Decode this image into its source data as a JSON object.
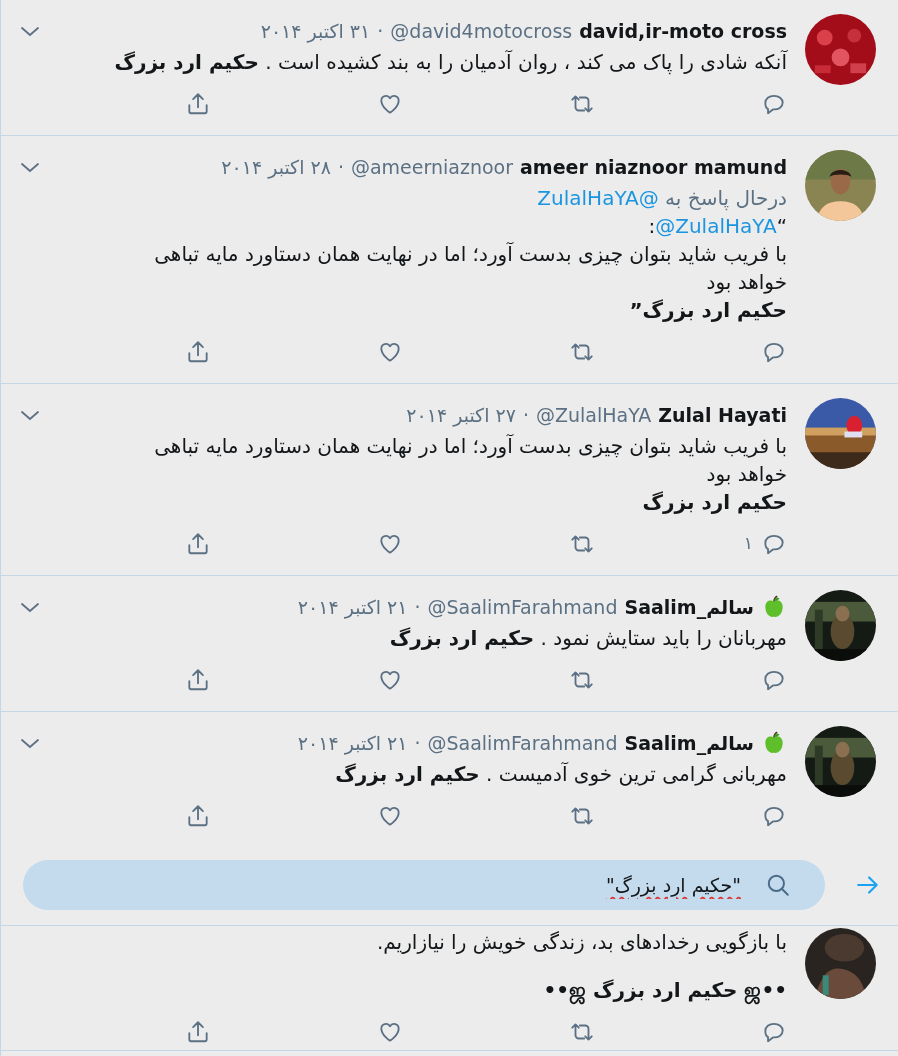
{
  "tweets": [
    {
      "avatar": {
        "kind": "picture"
      },
      "name": "david,ir-moto cross",
      "name_badge": false,
      "handle": "@david4motocross",
      "separator": "·",
      "date": "۳۱ اکتبر ۲۰۱۴",
      "menu": true,
      "body": [
        {
          "kind": "text",
          "text": "آنکه شادی را پاک می کند ، روان آدمیان را به بند کشیده است . **حکیم ارد بزرگ**"
        }
      ]
    },
    {
      "avatar": {
        "kind": "picture"
      },
      "name": "ameer niaznoor mamund",
      "name_badge": false,
      "handle": "@ameerniaznoor",
      "separator": "·",
      "date": "۲۸ اکتبر ۲۰۱۴",
      "menu": true,
      "reply_to": {
        "prefix": "درحال پاسخ به",
        "mention": "@ZulalHaYA"
      },
      "body": [
        {
          "kind": "mention",
          "before": "“",
          "mention": "@ZulalHaYA",
          "after": ":"
        },
        {
          "kind": "text",
          "text": "با فریب شاید بتوان چیزی بدست آورد؛ اما در نهایت همان دستاورد مایه تباهی خواهد بود"
        },
        {
          "kind": "signature",
          "text": "حکیم ارد بزرگ”"
        }
      ]
    },
    {
      "avatar": {
        "kind": "picture"
      },
      "name": "Zulal Hayati",
      "name_badge": false,
      "handle": "@ZulalHaYA",
      "separator": "·",
      "date": "۲۷ اکتبر ۲۰۱۴",
      "menu": true,
      "body": [
        {
          "kind": "text",
          "text": "با فریب شاید بتوان چیزی بدست آورد؛ اما در نهایت همان دستاورد مایه تباهی خواهد بود"
        },
        {
          "kind": "signature",
          "text": "حکیم ارد بزرگ"
        }
      ],
      "reply_count": "۱"
    },
    {
      "avatar": {
        "kind": "picture"
      },
      "name": "سالم_Saalim",
      "name_badge": true,
      "handle": "@SaalimFarahmand",
      "separator": "·",
      "date": "۲۱ اکتبر ۲۰۱۴",
      "menu": true,
      "body": [
        {
          "kind": "text",
          "text": "مهربانان را باید ستایش نمود . **حکیم ارد بزرگ**"
        }
      ]
    },
    {
      "avatar": {
        "kind": "picture"
      },
      "name": "سالم_Saalim",
      "name_badge": true,
      "handle": "@SaalimFarahmand",
      "separator": "·",
      "date": "۲۱ اکتبر ۲۰۱۴",
      "menu": true,
      "body": [
        {
          "kind": "text",
          "text": "مهربانی گرامی ترین خوی آدمیست . **حکیم ارد بزرگ**"
        }
      ]
    },
    {
      "avatar": {
        "kind": "picture"
      },
      "body": [
        {
          "kind": "text",
          "text": "با بازگویی رخدادهای بد، زندگی خویش را نیازاریم."
        },
        {
          "kind": "signature",
          "text": "••ஜ حکیم ارد بزرگ ஜ••",
          "gap_before": true
        }
      ]
    }
  ],
  "search": {
    "value": "\"حکیم ارد بزرگ\""
  }
}
